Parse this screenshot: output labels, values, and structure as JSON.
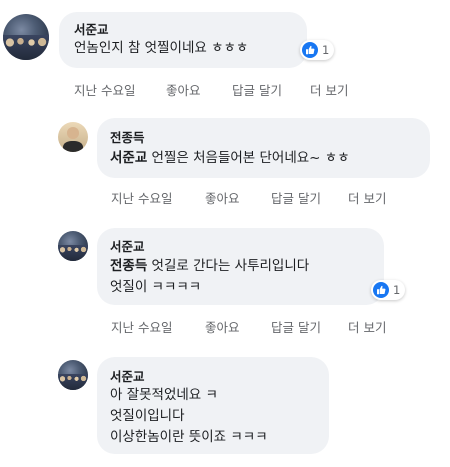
{
  "comments": [
    {
      "author": "서준교",
      "lines": [
        "언놈인지 참 엇찔이네요 ㅎㅎㅎ"
      ],
      "reaction_count": "1",
      "time": "지난 수요일",
      "like_label": "좋아요",
      "reply_label": "답글 달기",
      "more_label": "더 보기"
    },
    {
      "author": "전종득",
      "mention": "서준교",
      "lines": [
        " 언찔은 처음들어본 단어네요~ ㅎㅎ"
      ],
      "time": "지난 수요일",
      "like_label": "좋아요",
      "reply_label": "답글 달기",
      "more_label": "더 보기"
    },
    {
      "author": "서준교",
      "mention": "전종득",
      "lines": [
        " 엇길로 간다는 사투리입니다",
        "엇질이 ㅋㅋㅋㅋ"
      ],
      "reaction_count": "1",
      "time": "지난 수요일",
      "like_label": "좋아요",
      "reply_label": "답글 달기",
      "more_label": "더 보기"
    },
    {
      "author": "서준교",
      "lines": [
        "아 잘못적었네요 ㅋ",
        "엇질이입니다",
        "이상한놈이란 뜻이죠 ㅋㅋㅋ"
      ]
    }
  ],
  "icons": {
    "reaction": "thumbs-up-icon",
    "avatar_group": "group-photo-avatar",
    "avatar_person": "person-photo-avatar"
  },
  "colors": {
    "bubble": "#f0f2f5",
    "like_blue": "#1877f2",
    "meta_text": "#65676b"
  }
}
